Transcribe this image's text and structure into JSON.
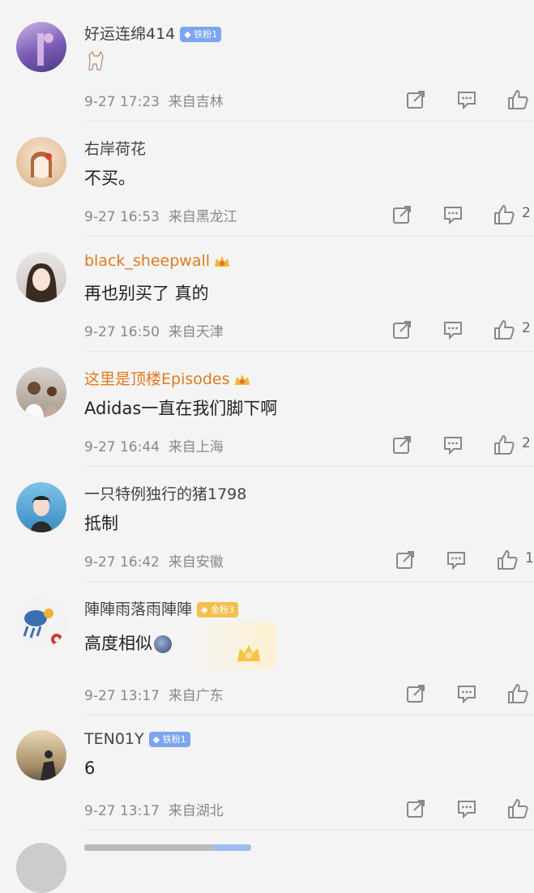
{
  "comments": [
    {
      "name": "好运连绵414",
      "badge": "铁粉1",
      "content": "",
      "time": "9-27 17:23",
      "location": "来自吉林",
      "likes": ""
    },
    {
      "name": "右岸荷花",
      "badge": "",
      "content": "不买。",
      "time": "9-27 16:53",
      "location": "来自黑龙江",
      "likes": "2"
    },
    {
      "name": "black_sheepwall",
      "badge": "",
      "content": "再也别买了 真的",
      "time": "9-27 16:50",
      "location": "来自天津",
      "likes": "2"
    },
    {
      "name": "这里是顶楼Episodes",
      "badge": "",
      "content": "Adidas一直在我们脚下啊",
      "time": "9-27 16:44",
      "location": "来自上海",
      "likes": "2"
    },
    {
      "name": "一只特例独行的猪1798",
      "badge": "",
      "content": "抵制",
      "time": "9-27 16:42",
      "location": "来自安徽",
      "likes": "1"
    },
    {
      "name": "陣陣雨落雨陣陣",
      "badge": "金粉3",
      "content": "高度相似",
      "time": "9-27 13:17",
      "location": "来自广东",
      "likes": ""
    },
    {
      "name": "TEN01Y",
      "badge": "铁粉1",
      "content": "6",
      "time": "9-27 13:17",
      "location": "来自湖北",
      "likes": ""
    }
  ],
  "icons": {
    "forward": "share-icon",
    "comment": "comment-icon",
    "like": "thumbs-up-icon"
  }
}
